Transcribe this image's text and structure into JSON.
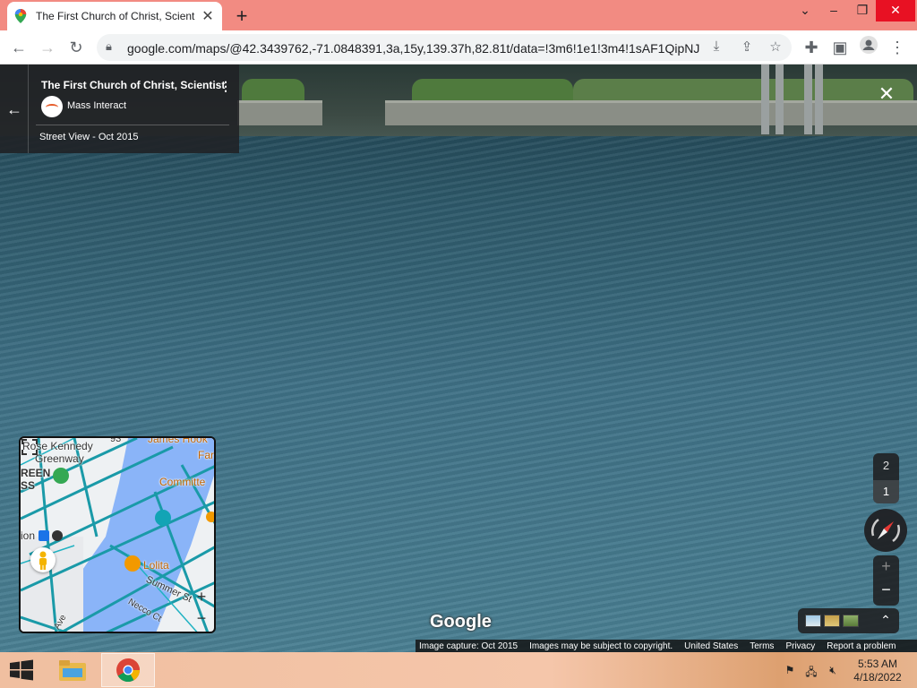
{
  "browser": {
    "tab_title": "The First Church of Christ, Scientist",
    "url": "google.com/maps/@42.3439762,-71.0848391,3a,15y,139.37h,82.81t/data=!3m6!1e1!3m4!1sAF1QipNJ...",
    "new_tab_symbol": "+",
    "icons": {
      "back": "back-arrow-icon",
      "forward": "forward-arrow-icon",
      "reload": "reload-icon",
      "lock": "lock-icon",
      "install": "install-app-icon",
      "share": "share-icon",
      "bookmark": "star-icon",
      "extensions": "puzzle-icon",
      "sidepanel": "side-panel-icon",
      "profile": "profile-icon",
      "menu": "kebab-menu-icon"
    },
    "tab_strip_color": "#f28b82"
  },
  "panel": {
    "title": "The First Church of Christ, Scientist",
    "contributor": "Mass Interact",
    "date": "Street View - Oct 2015"
  },
  "minimap": {
    "labels": {
      "rose": "Rose Kennedy",
      "greenway": "Greenway",
      "reen": "REEN",
      "ss": "SS",
      "ion": "ion",
      "james": "James Hook",
      "far": "Far",
      "committee": "Committe",
      "lolita": "Lolita",
      "summer": "Summer St",
      "necco": "Necco Ct",
      "ave": "Ave",
      "route": "93"
    },
    "zoom_in": "+",
    "zoom_out": "−"
  },
  "controls": {
    "level_upper": "2",
    "level_lower": "1",
    "zoom_in": "+",
    "zoom_out": "−",
    "layers_expand": "⌃"
  },
  "logo": "Google",
  "attribution": {
    "capture": "Image capture: Oct 2015",
    "copyright": "Images may be subject to copyright.",
    "country": "United States",
    "terms": "Terms",
    "privacy": "Privacy",
    "report": "Report a problem"
  },
  "taskbar": {
    "time": "5:53 AM",
    "date": "4/18/2022"
  }
}
